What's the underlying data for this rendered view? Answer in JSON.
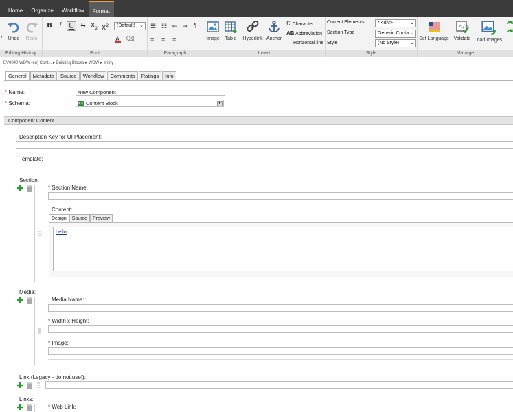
{
  "menu": [
    "Home",
    "Organize",
    "Workflow",
    "Format"
  ],
  "active_menu_index": 3,
  "ribbon": {
    "undo": "Undo",
    "redo": "Redo",
    "editing_history": "Editing History",
    "font_group": "Font",
    "font_select": "(Default)",
    "paragraph_group": "Paragraph",
    "insert_group": "Insert",
    "image": "Image",
    "table": "Table",
    "hyperlink": "Hyperlink",
    "anchor": "Anchor",
    "character": "Character",
    "abbreviation": "Abbreviation",
    "horizontal_line": "Horizontal line",
    "style_group": "Style",
    "current_elements_label": "Current Elements",
    "current_elements_value": "* <div>",
    "section_type_label": "Section Type",
    "section_type_value": "Generic Conta",
    "style_label": "Style",
    "style_value": "(No Style)",
    "manage_group": "Manage",
    "set_language": "Set Language",
    "validate": "Validate",
    "load_images": "Load Images"
  },
  "breadcrumb": "EV0040 WDW (en) Cont...  ▸  Building Blocks  ▸  WDW  ▸  entity",
  "tabs": [
    "General",
    "Metadata",
    "Source",
    "Workflow",
    "Comments",
    "Ratings",
    "Info"
  ],
  "form": {
    "name_label": "Name:",
    "name_value": "New Component",
    "schema_label": "Schema:",
    "schema_value": "Content Block",
    "section_title": "Component Content",
    "desc_key_label": "Description Key for UI Placement:",
    "template_label": "Template:",
    "section_label": "Section:",
    "section_name_label": "Section Name:",
    "content_label": "Content:",
    "editor_tabs": [
      "Design",
      "Source",
      "Preview"
    ],
    "editor_text": "hello",
    "media_label": "Media:",
    "media_name_label": "Media Name:",
    "width_height_label": "Width x Height:",
    "image_label": "Image:",
    "link_legacy_label": "Link (Legacy - do not use!):",
    "links_label": "Links:",
    "web_link_label": "Web Link:",
    "required_mark": "*"
  },
  "colors": {
    "menubar": "#3b3b3b",
    "accent": "#e8a33a",
    "add": "#2f9a2f",
    "link": "#123c8c"
  }
}
